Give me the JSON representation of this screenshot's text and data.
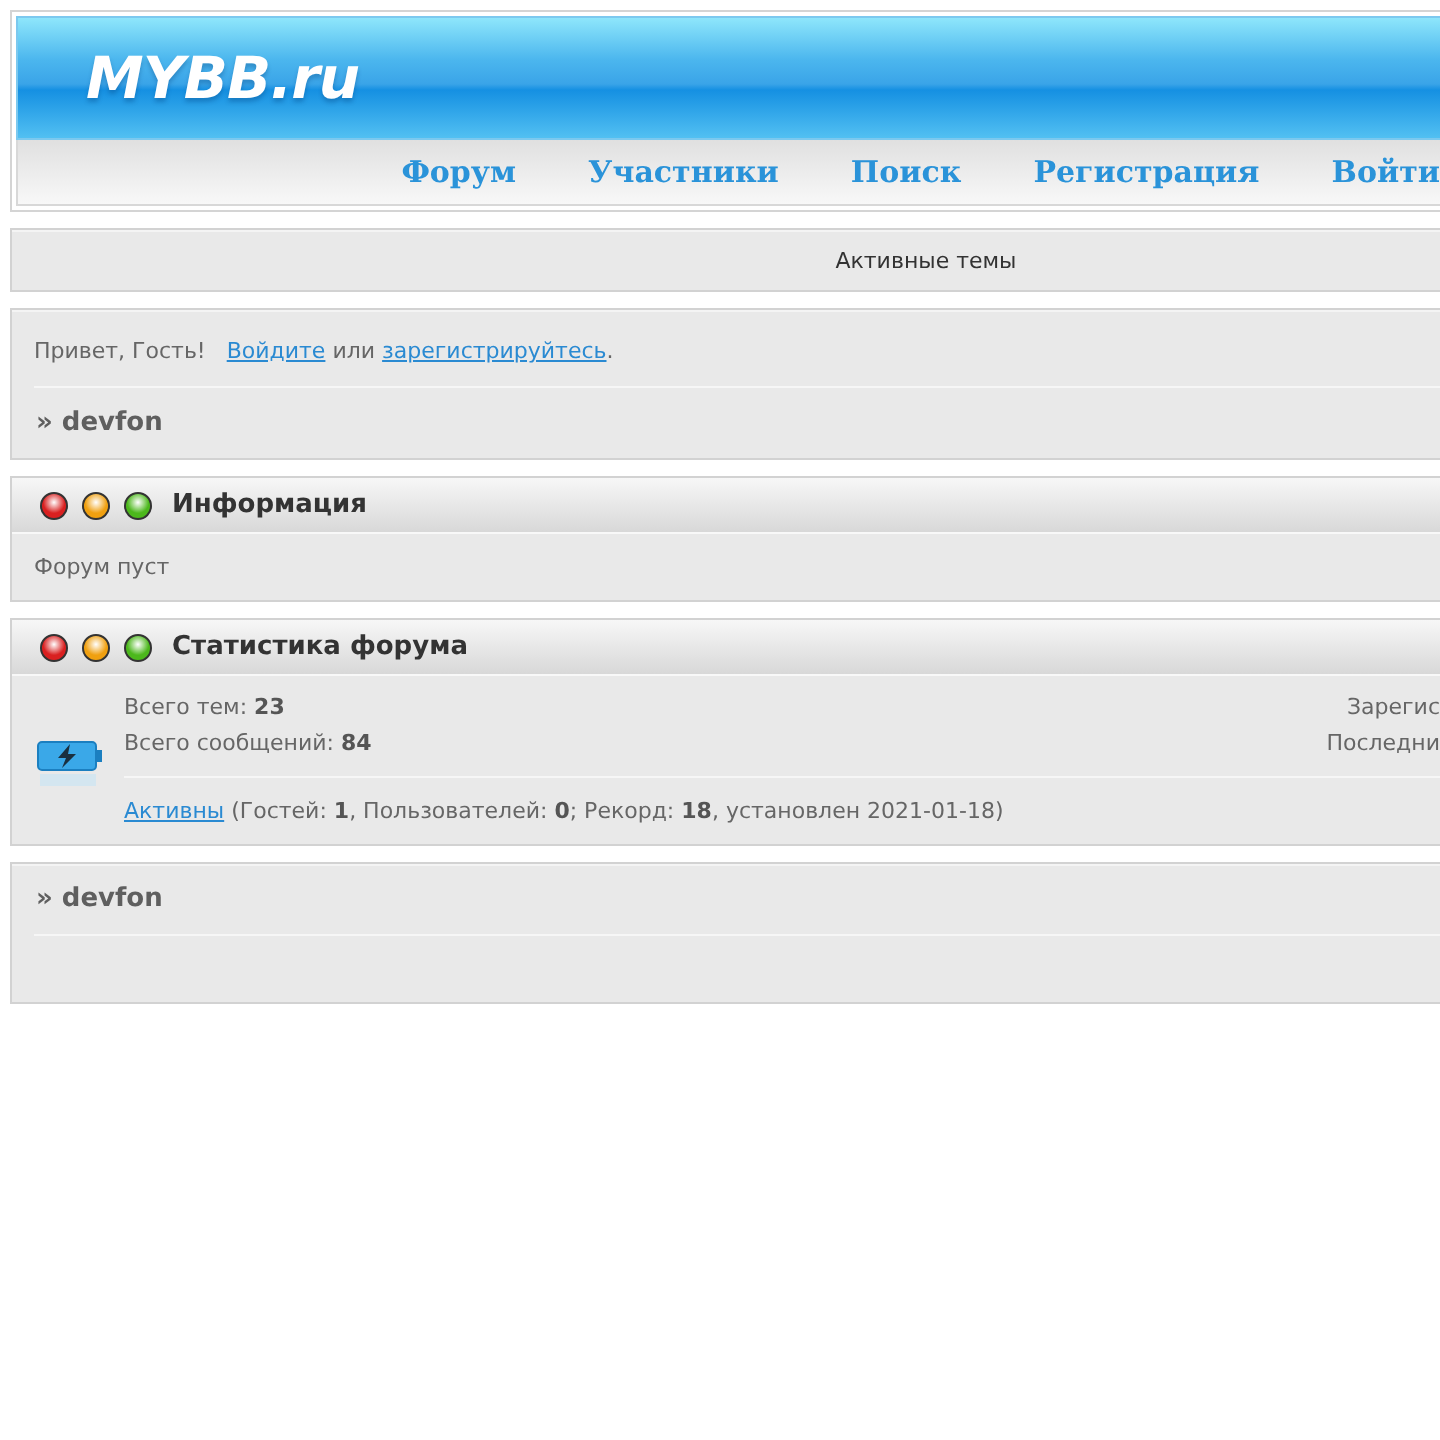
{
  "header": {
    "logo": "MYBB.ru",
    "nav": [
      "Форум",
      "Участники",
      "Поиск",
      "Регистрация",
      "Войти"
    ]
  },
  "active_topics": "Активные темы",
  "welcome": {
    "greeting": "Привет, Гость!",
    "login_link": "Войдите",
    "or": "или",
    "register_link": "зарегистрируйтесь",
    "end": "."
  },
  "breadcrumb": "» devfon",
  "info": {
    "title": "Информация",
    "text": "Форум пуст"
  },
  "stats": {
    "title": "Статистика форума",
    "left": [
      "Всего тем: **23**",
      "Всего сообщений: **84**"
    ],
    "right": [
      "Зарегис",
      "Последни"
    ],
    "online_link": "Активны",
    "online_text": "(Гостей: **1**, Пользователей: **0**; Рекорд: **18**, установлен 2021-01-18)"
  },
  "footer_breadcrumb": "» devfon"
}
